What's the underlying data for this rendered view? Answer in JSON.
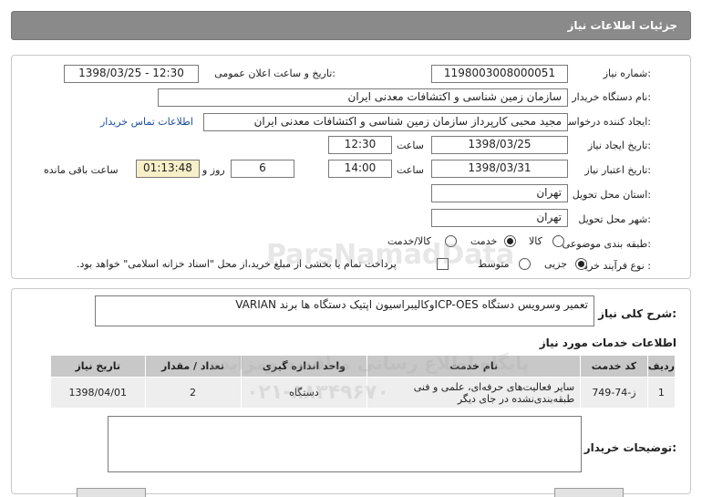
{
  "header": {
    "title": "جزئیات اطلاعات نیاز"
  },
  "form": {
    "need_number": {
      "label": "شماره نیاز:",
      "value": "1198003008000051"
    },
    "announce_datetime": {
      "label": "تاریخ و ساعت اعلان عمومی:",
      "value": "1398/03/25 - 12:30"
    },
    "buyer_org": {
      "label": "نام دستگاه خریدار:",
      "value": "سازمان زمین شناسی و اکتشافات معدنی ایران"
    },
    "requester": {
      "label": "ایجاد کننده درخواست:",
      "value": "مجید محبی کارپرداز سازمان زمین شناسی و اکتشافات معدنی ایران",
      "contact_link": "اطلاعات تماس خریدار"
    },
    "create_date": {
      "label": "تاریخ ایجاد نیاز:",
      "date": "1398/03/25",
      "time_label": "ساعت",
      "time": "12:30"
    },
    "validity": {
      "label": "تاریخ اعتبار نیاز:",
      "date": "1398/03/31",
      "time_label": "ساعت",
      "time": "14:00",
      "days": "6",
      "days_label": "روز و",
      "remaining": "01:13:48",
      "remaining_label": "ساعت باقی مانده"
    },
    "province": {
      "label": "استان محل تحویل:",
      "value": "تهران"
    },
    "city": {
      "label": "شهر محل تحویل:",
      "value": "تهران"
    },
    "category": {
      "label": "طبقه بندی موضوعی:",
      "options": [
        "کالا",
        "خدمت",
        "کالا/خدمت"
      ],
      "selected": "خدمت"
    },
    "process": {
      "label": "نوع فرآیند خرید :",
      "options": [
        "جزیی",
        "متوسط"
      ],
      "selected": "جزیی",
      "checkbox_text": "پرداخت تمام یا بخشی از مبلغ خرید،از محل \"اسناد خزانه اسلامی\" خواهد بود."
    }
  },
  "summary": {
    "label": "شرح کلی نیاز:",
    "value": "تعمیر وسرویس دستگاه ICP-OESوکالیبراسیون اپتیک دستگاه ها برند VARIAN"
  },
  "services": {
    "title": "اطلاعات خدمات مورد نیاز",
    "columns": [
      "ردیف",
      "کد خدمت",
      "نام خدمت",
      "واحد اندازه گیری",
      "تعداد / مقدار",
      "تاریخ نیاز"
    ],
    "rows": [
      {
        "row": "1",
        "code": "ز-74-749",
        "name": "سایر فعالیت‌های حرفه‌ای، علمی و فنی طبقه‌بندی‌نشده در جای دیگر",
        "unit": "دستگاه",
        "qty": "2",
        "date": "1398/04/01"
      }
    ]
  },
  "buyer_notes": {
    "label": "توضیحات خریدار:",
    "value": ""
  },
  "watermark": {
    "line1": "ParsNamadData",
    "line2": "پایگاه اطلاع رسانی مناقصه ومزایده",
    "line3": "۰۲۱-۸۸۳۴۹۶۷۰"
  },
  "colors": {
    "header_bg": "#8a8a8a",
    "remaining_bg": "#f7efc7",
    "link": "#1a4fa0",
    "table_header": "#c8c8c8",
    "table_row": "#eeeeee"
  }
}
